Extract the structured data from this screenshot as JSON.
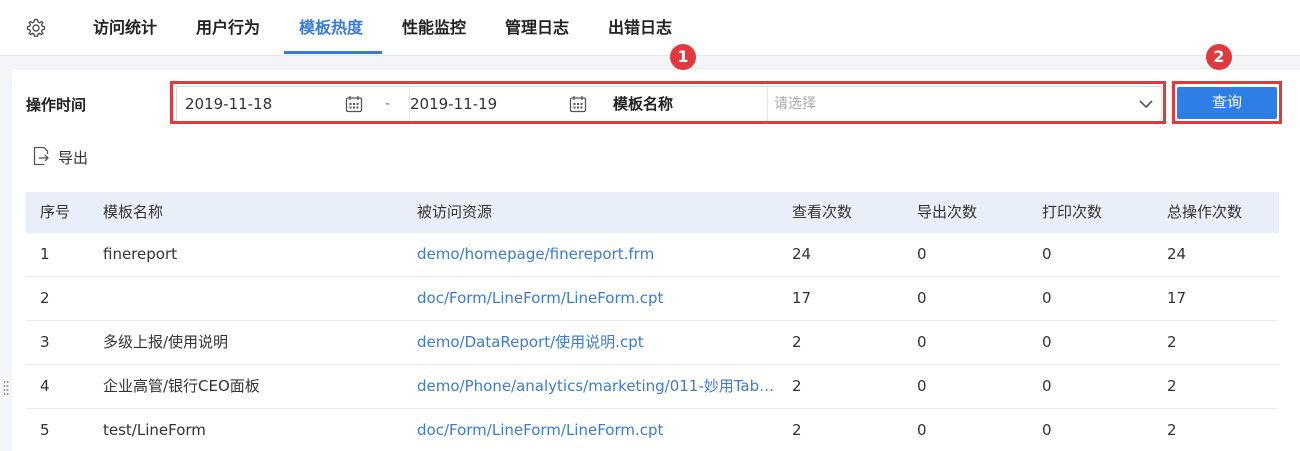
{
  "tabs": [
    {
      "label": "访问统计",
      "active": false
    },
    {
      "label": "用户行为",
      "active": false
    },
    {
      "label": "模板热度",
      "active": true
    },
    {
      "label": "性能监控",
      "active": false
    },
    {
      "label": "管理日志",
      "active": false
    },
    {
      "label": "出错日志",
      "active": false
    }
  ],
  "filter": {
    "time_label": "操作时间",
    "start_date": "2019-11-18",
    "separator": "-",
    "end_date": "2019-11-19",
    "template_label": "模板名称",
    "template_placeholder": "请选择",
    "query_label": "查询"
  },
  "badges": {
    "one": "1",
    "two": "2"
  },
  "export_label": "导出",
  "table": {
    "headers": [
      "序号",
      "模板名称",
      "被访问资源",
      "查看次数",
      "导出次数",
      "打印次数",
      "总操作次数"
    ],
    "rows": [
      [
        "1",
        "finereport",
        "demo/homepage/finereport.frm",
        "24",
        "0",
        "0",
        "24"
      ],
      [
        "2",
        "",
        "doc/Form/LineForm/LineForm.cpt",
        "17",
        "0",
        "0",
        "17"
      ],
      [
        "3",
        "多级上报/使用说明",
        "demo/DataReport/使用说明.cpt",
        "2",
        "0",
        "0",
        "2"
      ],
      [
        "4",
        "企业高管/银行CEO面板",
        "demo/Phone/analytics/marketing/011-妙用Tab页…",
        "2",
        "0",
        "0",
        "2"
      ],
      [
        "5",
        "test/LineForm",
        "doc/Form/LineForm/LineForm.cpt",
        "2",
        "0",
        "0",
        "2"
      ]
    ]
  },
  "colors": {
    "accent": "#3a7bd5",
    "highlight": "#e0393e",
    "button": "#2f7ee6",
    "header_bg": "#e9eff8"
  },
  "icons": {
    "settings": "gear-icon",
    "calendar": "calendar-icon",
    "dropdown": "chevron-down-icon",
    "export": "export-icon"
  }
}
